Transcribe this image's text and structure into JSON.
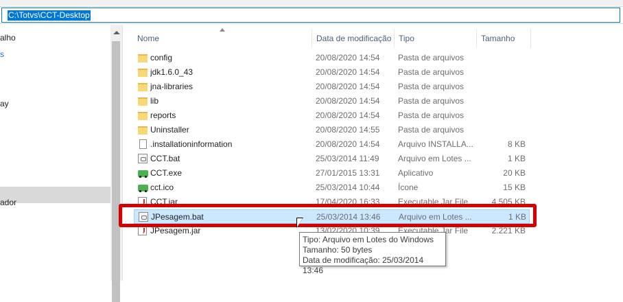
{
  "address_bar": {
    "path": "C:\\Totvs\\CCT-Desktop"
  },
  "nav_pane": {
    "items": [
      {
        "label": "alho",
        "link": false
      },
      {
        "label": "s",
        "link": true
      },
      {
        "label": "ay",
        "link": false
      },
      {
        "label": "ador",
        "link": false
      }
    ]
  },
  "columns": {
    "name": "Nome",
    "date": "Data de modificação",
    "type": "Tipo",
    "size": "Tamanho"
  },
  "files": [
    {
      "icon": "folder-icon",
      "name": "config",
      "date": "20/08/2020 14:54",
      "type": "Pasta de arquivos",
      "size": ""
    },
    {
      "icon": "folder-icon",
      "name": "jdk1.6.0_43",
      "date": "20/08/2020 14:54",
      "type": "Pasta de arquivos",
      "size": ""
    },
    {
      "icon": "folder-icon",
      "name": "jna-libraries",
      "date": "20/08/2020 14:54",
      "type": "Pasta de arquivos",
      "size": ""
    },
    {
      "icon": "folder-icon",
      "name": "lib",
      "date": "20/08/2020 14:54",
      "type": "Pasta de arquivos",
      "size": ""
    },
    {
      "icon": "folder-icon",
      "name": "reports",
      "date": "20/08/2020 14:54",
      "type": "Pasta de arquivos",
      "size": ""
    },
    {
      "icon": "folder-icon",
      "name": "Uninstaller",
      "date": "20/08/2020 14:55",
      "type": "Pasta de arquivos",
      "size": ""
    },
    {
      "icon": "file-icon",
      "name": ".installationinformation",
      "date": "20/08/2020 14:54",
      "type": "Arquivo INSTALLA...",
      "size": "8 KB"
    },
    {
      "icon": "batch-file-icon",
      "name": "CCT.bat",
      "date": "25/03/2014 11:49",
      "type": "Arquivo em Lotes ...",
      "size": "1 KB"
    },
    {
      "icon": "truck-icon",
      "name": "CCT.exe",
      "date": "27/01/2015 13:31",
      "type": "Aplicativo",
      "size": "20 KB"
    },
    {
      "icon": "truck-icon",
      "name": "cct.ico",
      "date": "25/03/2014 10:44",
      "type": "Ícone",
      "size": "15 KB"
    },
    {
      "icon": "jar-file-icon",
      "name": "CCT.jar",
      "date": "17/04/2020 16:33",
      "type": "Executable Jar File",
      "size": "4.505 KB"
    },
    {
      "icon": "batch-file-icon",
      "name": "JPesagem.bat",
      "date": "25/03/2014 13:46",
      "type": "Arquivo em Lotes ...",
      "size": "1 KB"
    },
    {
      "icon": "jar-file-icon",
      "name": "JPesagem.jar",
      "date": "13/02/2020 10:39",
      "type": "Executable Jar File",
      "size": "2.221 KB"
    }
  ],
  "selected_file": "JPesagem.bat",
  "tooltip": {
    "type_line": "Tipo: Arquivo em Lotes do Windows",
    "size_line": "Tamanho: 50 bytes",
    "date_line": "Data de modificação: 25/03/2014 13:46"
  },
  "colors": {
    "selection": "#cce8ff",
    "highlight": "#d60000",
    "accent": "#0078d7"
  }
}
